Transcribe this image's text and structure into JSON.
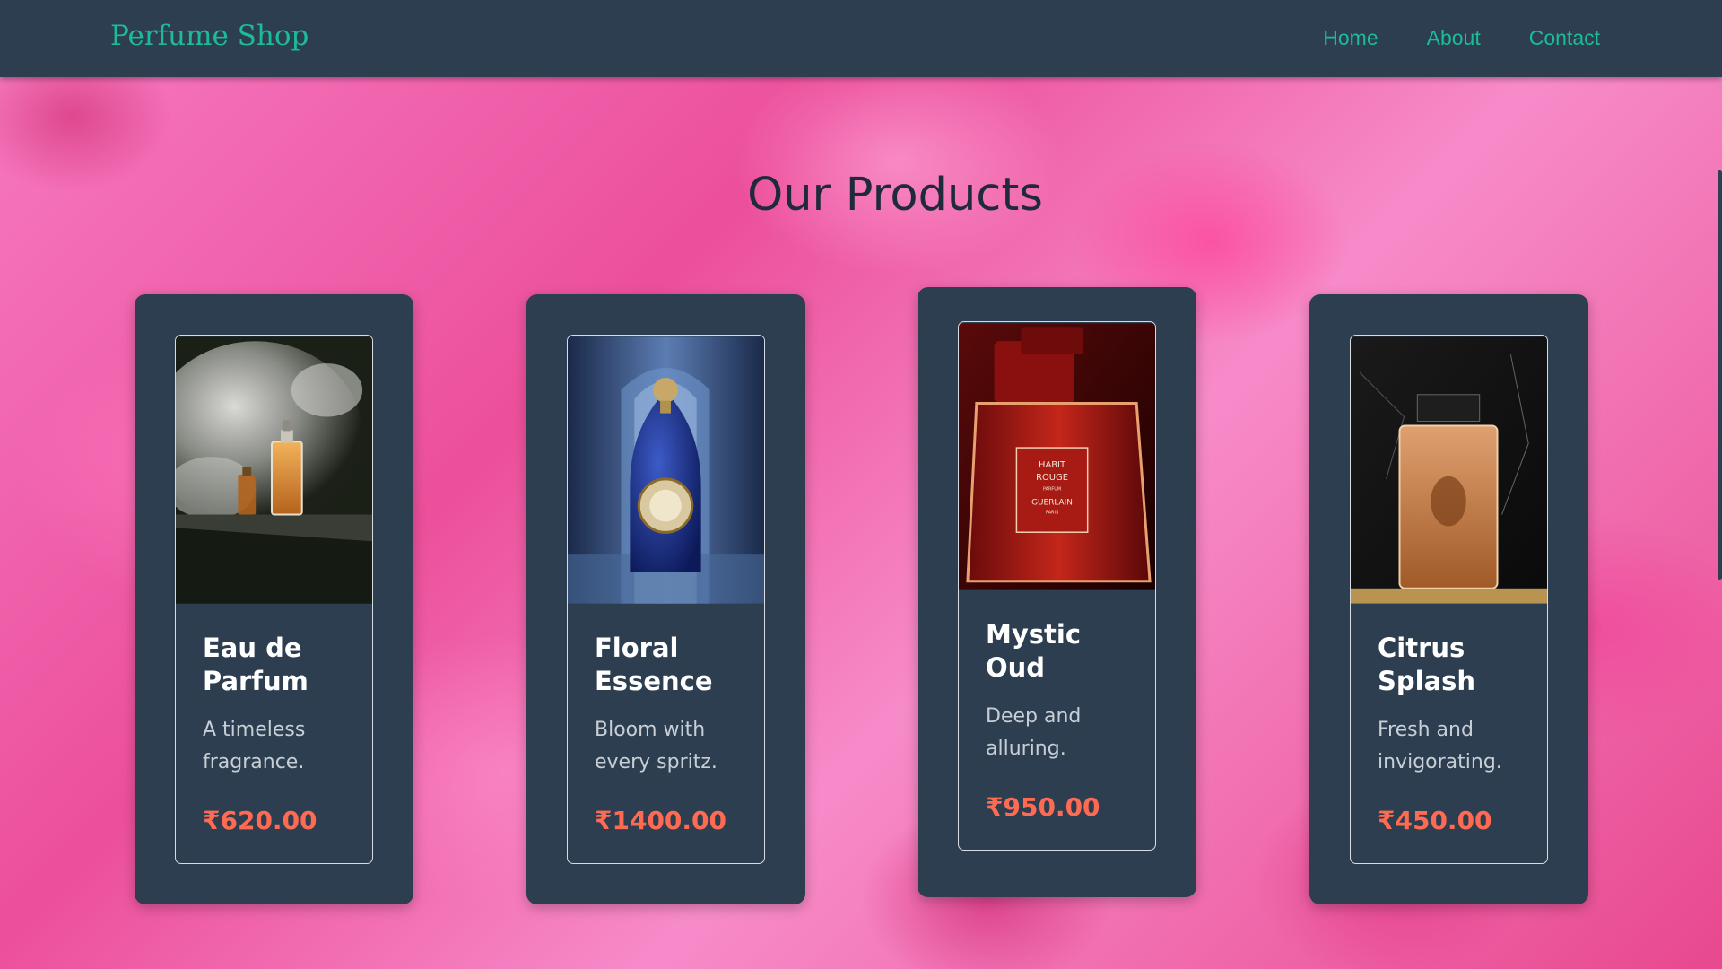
{
  "colors": {
    "navbar": "#2c3e50",
    "accent": "#1abc9c",
    "price": "#ff6b52",
    "background": "#f06aab"
  },
  "nav": {
    "brand": "Perfume Shop",
    "links": [
      "Home",
      "About",
      "Contact"
    ]
  },
  "page": {
    "title": "Our Products"
  },
  "products": [
    {
      "name": "Eau de Parfum",
      "description": "A timeless fragrance.",
      "price": "₹620.00",
      "image_icon": "perfume-bottle-smoke"
    },
    {
      "name": "Floral Essence",
      "description": "Bloom with every spritz.",
      "price": "₹1400.00",
      "image_icon": "perfume-bottle-blue"
    },
    {
      "name": "Mystic Oud",
      "description": "Deep and alluring.",
      "price": "₹950.00",
      "image_icon": "perfume-bottle-red",
      "bottle_label": [
        "HABIT",
        "ROUGE",
        "PARFUM",
        "GUERLAIN",
        "PARIS"
      ]
    },
    {
      "name": "Citrus Splash",
      "description": "Fresh and invigorating.",
      "price": "₹450.00",
      "image_icon": "perfume-bottle-amber"
    }
  ]
}
